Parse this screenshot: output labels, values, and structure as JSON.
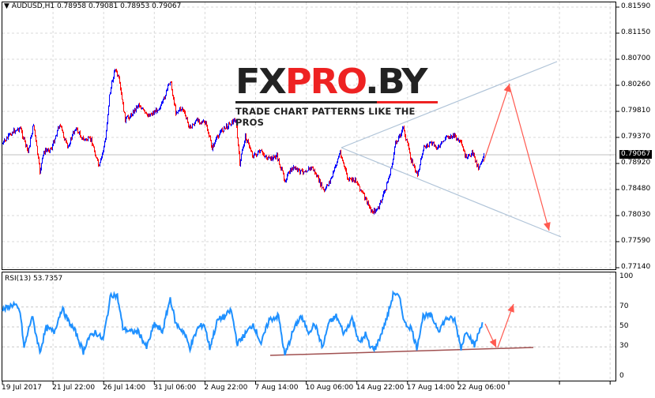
{
  "header": {
    "symbol": "AUDUSD,H1",
    "ohlc": "0.78958 0.79081 0.78953 0.79067",
    "current_price": "0.79067"
  },
  "logo": {
    "part1": "FX",
    "part2": "PRO",
    "part3": ".BY",
    "tagline": "TRADE CHART PATTERNS LIKE THE PROS"
  },
  "price_axis": [
    "0.81590",
    "0.81150",
    "0.80700",
    "0.80260",
    "0.79810",
    "0.79370",
    "0.78920",
    "0.78480",
    "0.78030",
    "0.77590",
    "0.77140"
  ],
  "rsi": {
    "label": "RSI(13) 53.7357",
    "levels": [
      "100",
      "70",
      "50",
      "30",
      "0"
    ]
  },
  "time_axis": [
    "19 Jul 2017",
    "21 Jul 22:00",
    "26 Jul 14:00",
    "31 Jul 06:00",
    "2 Aug 22:00",
    "7 Aug 14:00",
    "10 Aug 06:00",
    "14 Aug 22:00",
    "17 Aug 14:00",
    "22 Aug 06:00"
  ],
  "colors": {
    "bull": "#0000ff",
    "bear": "#ff0000",
    "rsi": "#1e90ff",
    "arrow": "#ff5a50",
    "pattern": "#b0c4d8",
    "trend": "#a05050"
  },
  "chart_data": {
    "type": "line",
    "price": {
      "x_bars": [
        0,
        12,
        22,
        32,
        39,
        47,
        52,
        62,
        72,
        82,
        92,
        102,
        112,
        122,
        130,
        135,
        142,
        147,
        155,
        162,
        172,
        182,
        192,
        202,
        212,
        219,
        227,
        237,
        247,
        257,
        265,
        275,
        287,
        295,
        300,
        307,
        317,
        327,
        337,
        347,
        357,
        367,
        377,
        392,
        407,
        417,
        427,
        437,
        447,
        457,
        467,
        475,
        485,
        492,
        497,
        507,
        517,
        525,
        532,
        542,
        552,
        562,
        572,
        580,
        587,
        594,
        602,
        609
      ],
      "values": [
        0.7926,
        0.7946,
        0.7953,
        0.7912,
        0.796,
        0.7878,
        0.7912,
        0.7919,
        0.796,
        0.7919,
        0.7953,
        0.7933,
        0.7933,
        0.7885,
        0.7933,
        0.8008,
        0.8055,
        0.8035,
        0.7967,
        0.7974,
        0.7994,
        0.7974,
        0.798,
        0.7994,
        0.8035,
        0.798,
        0.7987,
        0.7953,
        0.7967,
        0.796,
        0.7919,
        0.7946,
        0.796,
        0.7967,
        0.7892,
        0.7939,
        0.7905,
        0.7912,
        0.7899,
        0.7905,
        0.7864,
        0.7885,
        0.7878,
        0.7885,
        0.7844,
        0.7871,
        0.7912,
        0.7864,
        0.7864,
        0.7837,
        0.781,
        0.7814,
        0.7851,
        0.7885,
        0.7926,
        0.7953,
        0.7899,
        0.7871,
        0.7919,
        0.7926,
        0.7919,
        0.7939,
        0.7939,
        0.7926,
        0.7899,
        0.7912,
        0.7885,
        0.7907
      ],
      "ylim": [
        0.7714,
        0.8159
      ]
    },
    "rsi": {
      "x_bars": [
        0,
        14,
        22,
        27,
        37,
        47,
        55,
        65,
        75,
        82,
        92,
        102,
        107,
        117,
        127,
        137,
        145,
        152,
        162,
        172,
        182,
        192,
        202,
        212,
        219,
        229,
        237,
        247,
        255,
        262,
        272,
        282,
        289,
        297,
        307,
        317,
        327,
        337,
        349,
        357,
        367,
        377,
        387,
        395,
        405,
        412,
        422,
        432,
        442,
        452,
        459,
        465,
        472,
        479,
        487,
        495,
        502,
        509,
        517,
        524,
        532,
        542,
        552,
        562,
        572,
        580,
        587,
        597,
        607
      ],
      "values": [
        67,
        73,
        65,
        29,
        61,
        25,
        49,
        45,
        69,
        57,
        45,
        25,
        37,
        45,
        37,
        83,
        81,
        49,
        45,
        45,
        29,
        53,
        45,
        79,
        53,
        45,
        29,
        49,
        53,
        29,
        57,
        61,
        67,
        33,
        43,
        53,
        33,
        57,
        61,
        21,
        45,
        61,
        45,
        53,
        29,
        53,
        61,
        43,
        59,
        33,
        43,
        29,
        29,
        43,
        61,
        85,
        79,
        53,
        49,
        29,
        61,
        61,
        47,
        59,
        57,
        29,
        47,
        31,
        55
      ],
      "ylim": [
        0,
        100
      ]
    }
  }
}
